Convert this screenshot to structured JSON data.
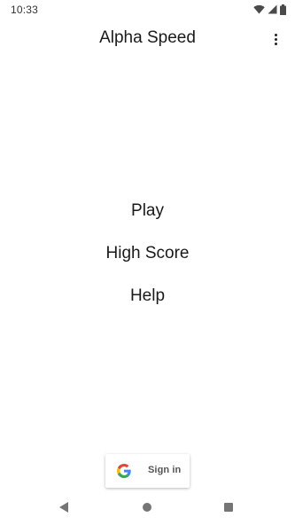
{
  "status_bar": {
    "time": "10:33",
    "icons": [
      "wifi-icon",
      "cellular-signal-icon",
      "battery-icon"
    ]
  },
  "app_bar": {
    "title": "Alpha Speed",
    "overflow_icon": "more-vert-icon"
  },
  "menu": {
    "items": [
      {
        "label": "Play"
      },
      {
        "label": "High Score"
      },
      {
        "label": "Help"
      }
    ]
  },
  "signin": {
    "label": "Sign in",
    "icon": "google-g-icon"
  },
  "nav_bar": {
    "icons": [
      "back-icon",
      "home-icon",
      "recents-icon"
    ]
  },
  "colors": {
    "background": "#ffffff",
    "text": "#1a1a1a",
    "nav_icon": "#757575",
    "google_blue": "#4285F4",
    "google_red": "#EA4335",
    "google_yellow": "#FBBC05",
    "google_green": "#34A853"
  }
}
